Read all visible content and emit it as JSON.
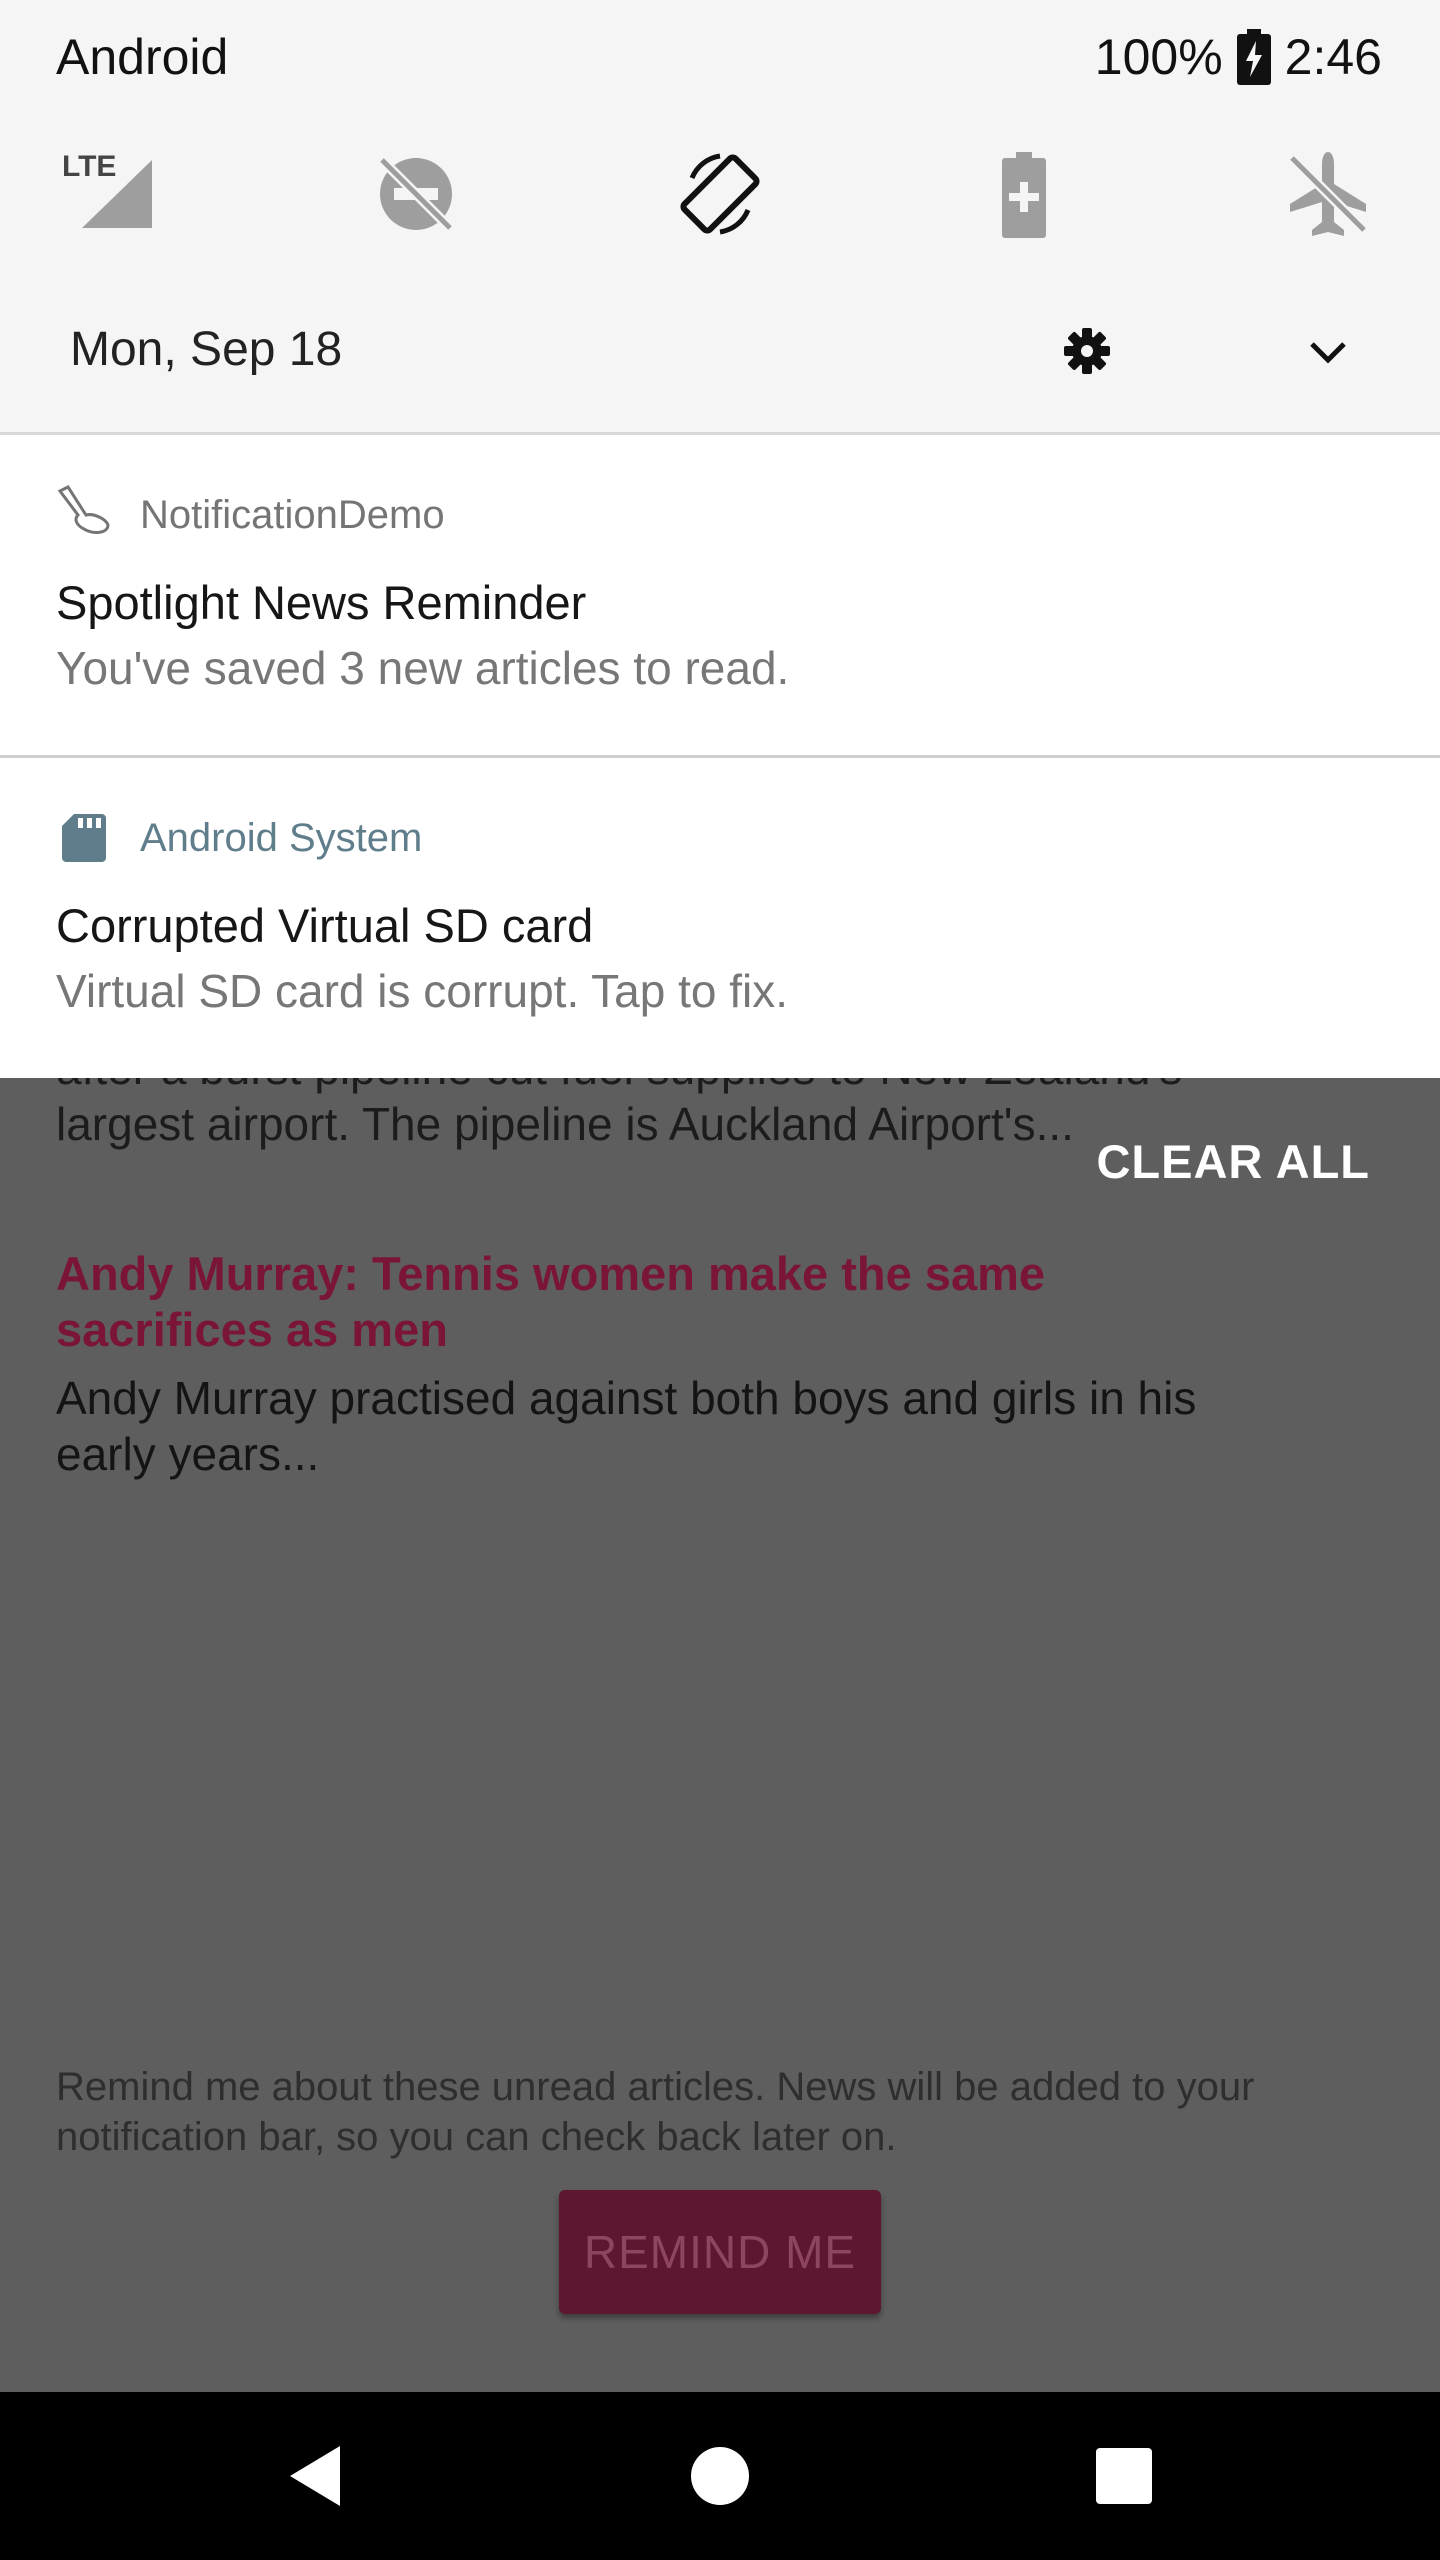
{
  "status_bar": {
    "carrier": "Android",
    "battery": "100%",
    "time": "2:46"
  },
  "quick_settings": {
    "tiles": [
      {
        "icon": "lte-signal-icon",
        "label": "LTE"
      },
      {
        "icon": "do-not-disturb-icon"
      },
      {
        "icon": "auto-rotate-icon"
      },
      {
        "icon": "battery-saver-icon"
      },
      {
        "icon": "airplane-mode-icon"
      }
    ],
    "date": "Mon, Sep 18"
  },
  "notifications": [
    {
      "app": "NotificationDemo",
      "title": "Spotlight News Reminder",
      "text": "You've saved 3 new articles to read.",
      "app_color": "#757575"
    },
    {
      "app": "Android System",
      "title": "Corrupted Virtual SD card",
      "text": "Virtual SD card is corrupt. Tap to fix.",
      "app_color": "#607d8b"
    }
  ],
  "clear_all": "CLEAR ALL",
  "app": {
    "article_tail_line1": "after a burst pipeline cut fuel supplies to New Zealand's",
    "article_tail_line2": "largest airport. The pipeline is Auckland Airport's...",
    "article_title": "Andy Murray: Tennis women make the same sacrifices as men",
    "article_snippet": "Andy Murray practised against both boys and girls in his early years...",
    "remind_text": "Remind me about these unread articles. News will be added to your notification bar, so you can check back later on.",
    "remind_button": "REMIND ME"
  },
  "colors": {
    "accent": "#7a1537",
    "shade_bg": "#f5f5f5",
    "scrim": "#5e5e5e"
  }
}
